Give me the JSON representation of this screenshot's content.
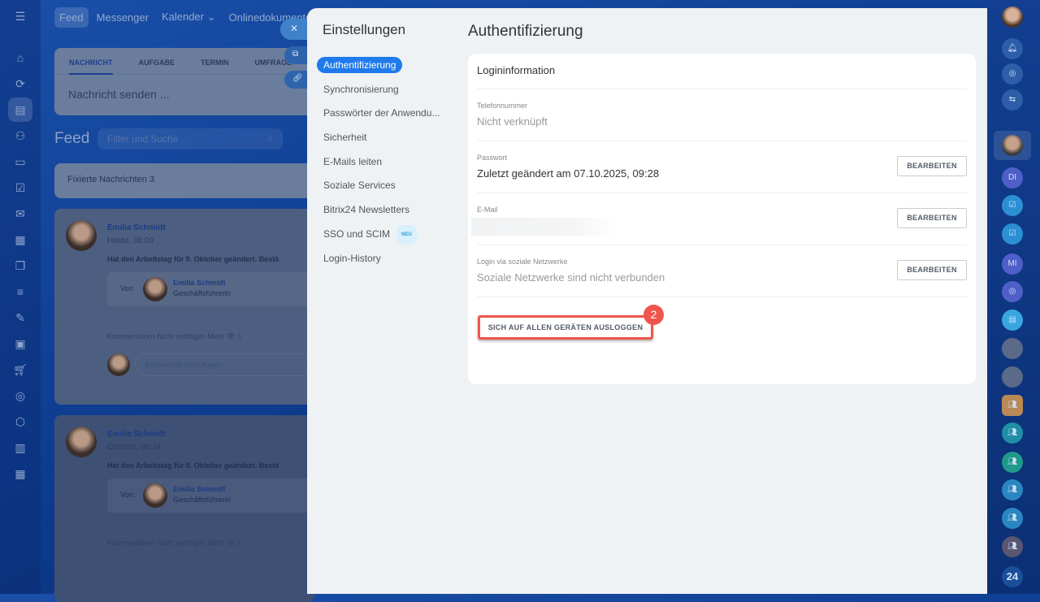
{
  "topnav": [
    "Feed",
    "Messenger",
    "Kalender ⌄",
    "Onlinedokumente"
  ],
  "composer": {
    "tabs": [
      "NACHRICHT",
      "AUFGABE",
      "TERMIN",
      "UMFRAGE"
    ],
    "placeholder": "Nachricht senden ..."
  },
  "feed": {
    "title": "Feed",
    "filter_placeholder": "Filter und Suche",
    "pinned": "Fixierte Nachrichten  3",
    "posts": [
      {
        "author": "Emilia Schmidt",
        "time": "Heute, 06:09",
        "text": "Hat den Arbeitstag für 9. Oktober geändert. Bestä",
        "from_label": "Von:",
        "from_name": "Emilia Schmidt",
        "from_role": "Geschäftsführerin",
        "actions": "Kommentieren   Nicht verfolgen   Mehr   👁 1",
        "comment_placeholder": "Kommentar hinzufügen"
      },
      {
        "author": "Emilia Schmidt",
        "time": "Gestern, 06:34",
        "text": "Hat den Arbeitstag für 8. Oktober geändert. Bestä",
        "from_label": "Von:",
        "from_name": "Emilia Schmidt",
        "from_role": "Geschäftsführerin",
        "actions": "Kommentieren   Nicht verfolgen   Mehr   👁 1"
      }
    ]
  },
  "settings": {
    "title": "Einstellungen",
    "nav": [
      "Authentifizierung",
      "Synchronisierung",
      "Passwörter der Anwendu...",
      "Sicherheit",
      "E-Mails leiten",
      "Soziale Services",
      "Bitrix24 Newsletters",
      "SSO und SCIM",
      "Login-History"
    ],
    "new_badge": "NEU"
  },
  "auth": {
    "title": "Authentifizierung",
    "section": "Logininformation",
    "phone_label": "Telefonnummer",
    "phone_value": "Nicht verknüpft",
    "password_label": "Passwort",
    "password_value": "Zuletzt geändert am 07.10.2025, 09:28",
    "email_label": "E-Mail",
    "social_label": "Login via soziale Netzwerke",
    "social_value": "Soziale Netzwerke sind nicht verbunden",
    "edit": "BEARBEITEN",
    "logout": "SICH AUF ALLEN GERÄTEN AUSLOGGEN",
    "step": "2"
  },
  "rightbar": {
    "items": [
      "DI",
      "MI",
      "24"
    ]
  }
}
